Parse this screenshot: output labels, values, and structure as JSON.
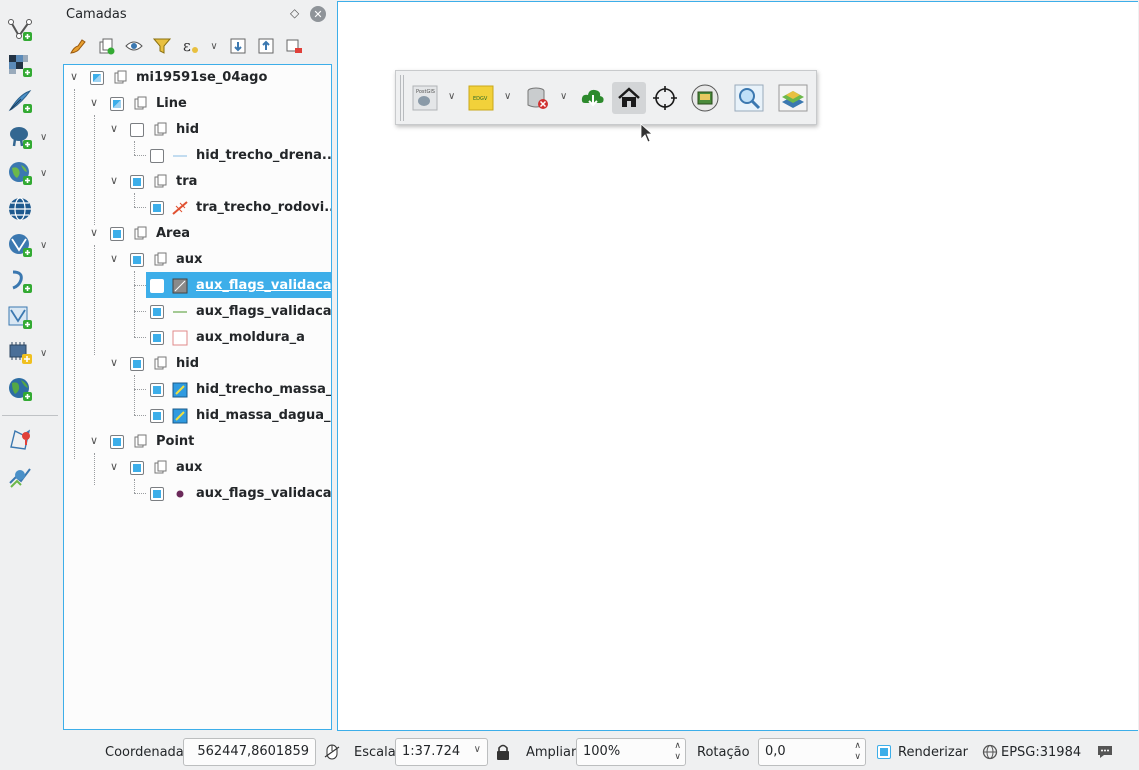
{
  "panel": {
    "title": "Camadas",
    "float_glyph": "◇",
    "close_glyph": "✕",
    "toolbar_icons": [
      "paint-brush-icon",
      "add-group-icon",
      "eye-icon",
      "filter-icon",
      "expression-filter-icon",
      "expand-all-icon",
      "collapse-all-icon",
      "remove-layer-icon"
    ]
  },
  "vtoolbar_icons": [
    "new-vector-layer-icon",
    "add-raster-layer-icon",
    "digitize-icon",
    "postgis-elephant-icon",
    "wms-globe-icon",
    "wcs-globe-icon",
    "wfs-vector-icon",
    "virtual-layer-icon",
    "vector-tile-icon",
    "mesh-chip-icon",
    "xyz-globe-icon",
    "georeferencer-icon",
    "spatial-bookmark-icon"
  ],
  "tree": [
    {
      "label": "mi19591se_04ago",
      "type": "group",
      "checked": "partial"
    },
    {
      "label": "Line",
      "type": "group",
      "checked": "partial"
    },
    {
      "label": "hid",
      "type": "group",
      "checked": "off"
    },
    {
      "label": "hid_trecho_drena...",
      "type": "layer",
      "checked": "off",
      "icon": "line-symbol-icon"
    },
    {
      "label": "tra",
      "type": "group",
      "checked": "on"
    },
    {
      "label": "tra_trecho_rodovi...",
      "type": "layer",
      "checked": "on",
      "icon": "road-symbol-icon"
    },
    {
      "label": "Area",
      "type": "group",
      "checked": "on"
    },
    {
      "label": "aux",
      "type": "group",
      "checked": "on"
    },
    {
      "label": "aux_flags_validaca...",
      "type": "layer",
      "checked": "off",
      "icon": "polygon-hatched-icon",
      "selected": true
    },
    {
      "label": "aux_flags_validaca...",
      "type": "layer",
      "checked": "on",
      "icon": "line-green-icon"
    },
    {
      "label": "aux_moldura_a",
      "type": "layer",
      "checked": "on",
      "icon": "polygon-empty-icon"
    },
    {
      "label": "hid",
      "type": "group",
      "checked": "on"
    },
    {
      "label": "hid_trecho_massa_...",
      "type": "layer",
      "checked": "on",
      "icon": "polygon-blue-icon"
    },
    {
      "label": "hid_massa_dagua_a",
      "type": "layer",
      "checked": "on",
      "icon": "polygon-blue-icon"
    },
    {
      "label": "Point",
      "type": "group",
      "checked": "on"
    },
    {
      "label": "aux",
      "type": "group",
      "checked": "on"
    },
    {
      "label": "aux_flags_validaca...",
      "type": "layer",
      "checked": "on",
      "icon": "point-purple-icon"
    }
  ],
  "floating_toolbar": {
    "buttons": [
      "postgis-icon",
      "edgv-icon",
      "database-delete-icon",
      "cloud-download-icon",
      "home-icon",
      "crosshair-icon",
      "layers-book-icon",
      "magnifier-icon",
      "map-layers-icon"
    ],
    "edgv_label": "EDGV",
    "postgis_label": "PostGIS"
  },
  "status": {
    "coord_label": "Coordenada",
    "coord_value": "562447,8601859",
    "scale_label": "Escala",
    "scale_value": "1:37.724",
    "zoom_label": "Ampliar",
    "zoom_value": "100%",
    "rotation_label": "Rotação",
    "rotation_value": "0,0",
    "render_label": "Renderizar",
    "crs_label": "EPSG:31984"
  }
}
